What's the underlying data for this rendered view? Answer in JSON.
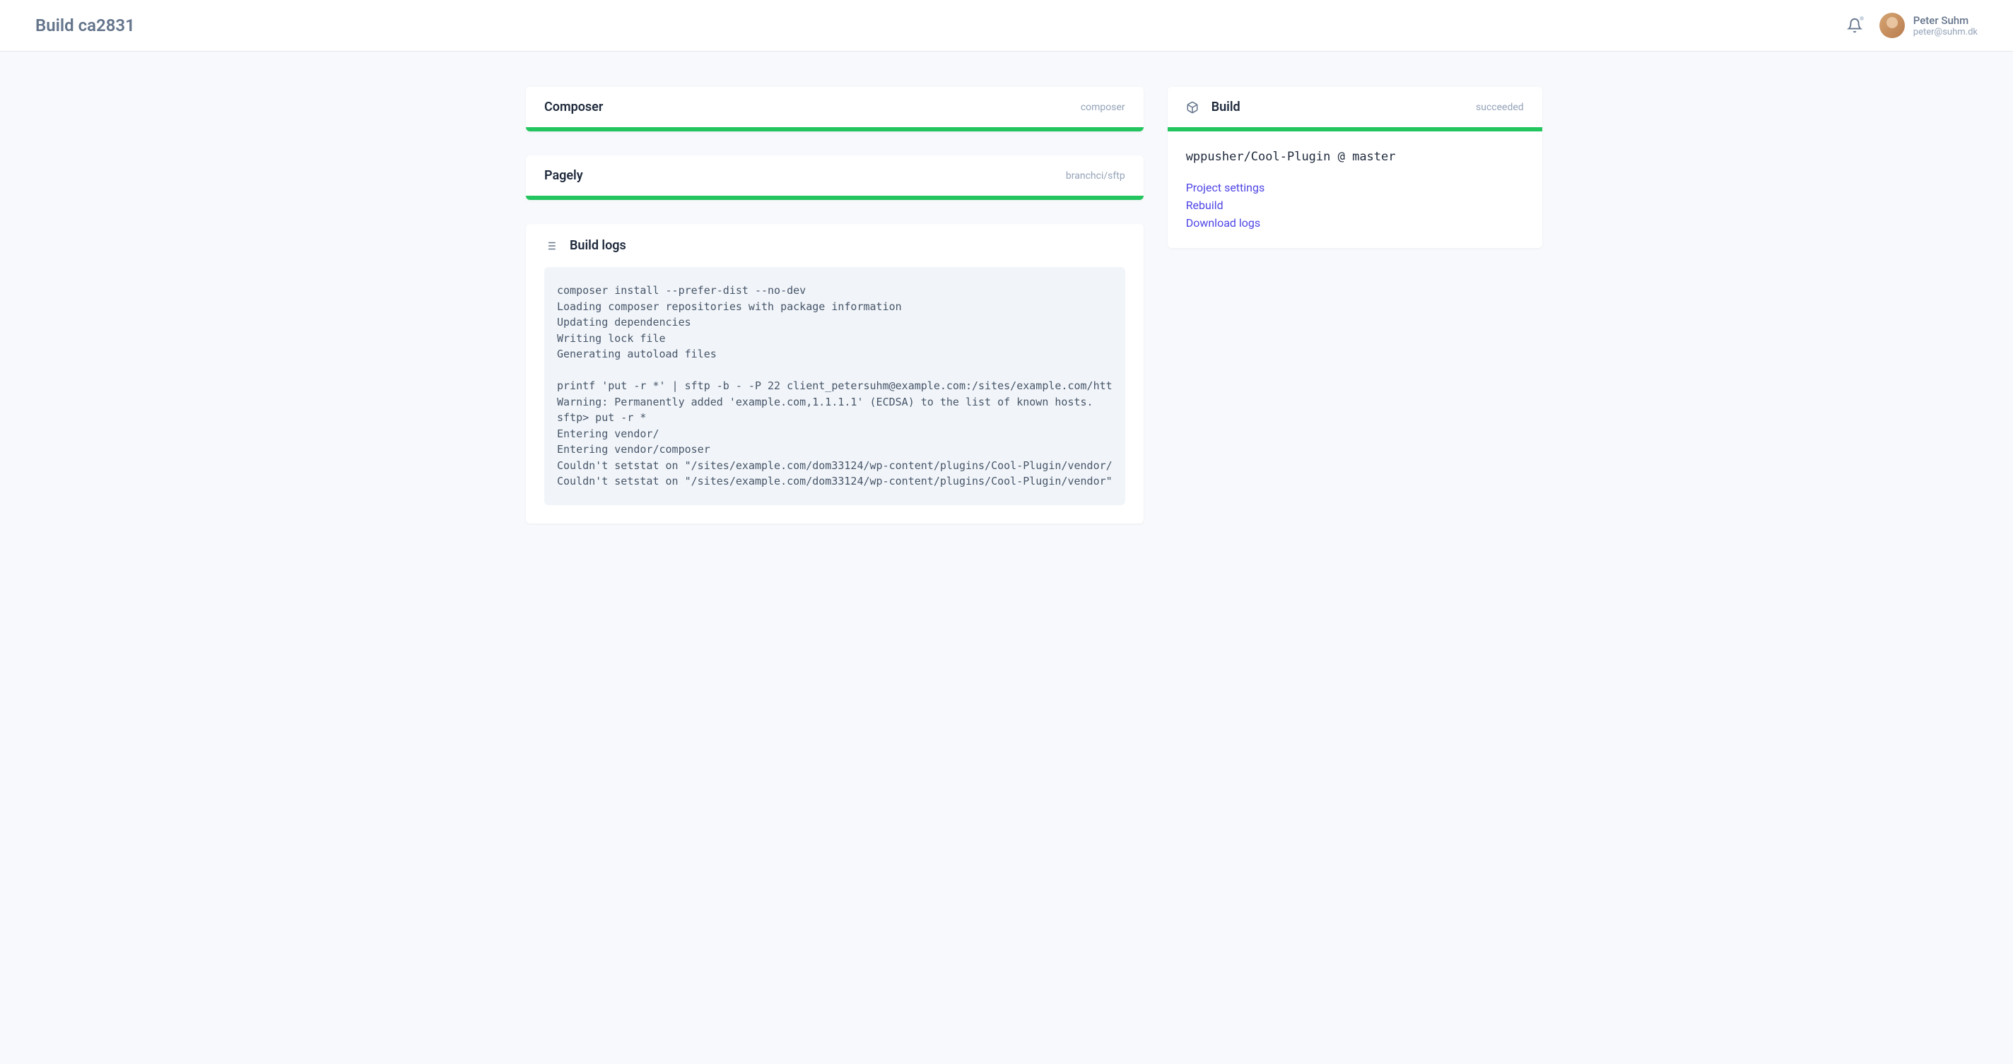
{
  "header": {
    "title": "Build ca2831",
    "user": {
      "name": "Peter Suhm",
      "email": "peter@suhm.dk"
    }
  },
  "steps": [
    {
      "title": "Composer",
      "meta": "composer"
    },
    {
      "title": "Pagely",
      "meta": "branchci/sftp"
    }
  ],
  "logs": {
    "title": "Build logs",
    "content": "composer install --prefer-dist --no-dev\nLoading composer repositories with package information\nUpdating dependencies\nWriting lock file\nGenerating autoload files\n\nprintf 'put -r *' | sftp -b - -P 22 client_petersuhm@example.com:/sites/example.com/htt\nWarning: Permanently added 'example.com,1.1.1.1' (ECDSA) to the list of known hosts.\nsftp> put -r *\nEntering vendor/\nEntering vendor/composer\nCouldn't setstat on \"/sites/example.com/dom33124/wp-content/plugins/Cool-Plugin/vendor/\nCouldn't setstat on \"/sites/example.com/dom33124/wp-content/plugins/Cool-Plugin/vendor\""
  },
  "build": {
    "title": "Build",
    "status": "succeeded",
    "repo": "wppusher/Cool-Plugin @ master",
    "actions": {
      "settings": "Project settings",
      "rebuild": "Rebuild",
      "download": "Download logs"
    }
  }
}
